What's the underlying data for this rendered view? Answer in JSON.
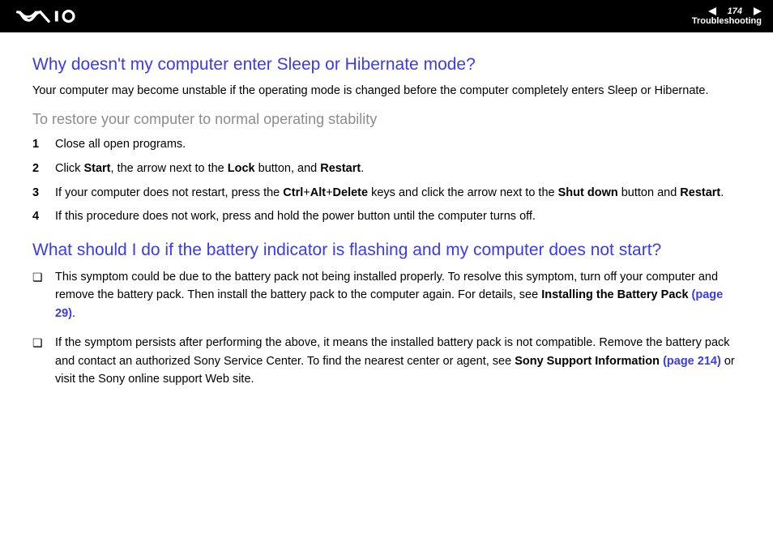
{
  "header": {
    "page_number": "174",
    "section": "Troubleshooting"
  },
  "q1": {
    "heading": "Why doesn't my computer enter Sleep or Hibernate mode?",
    "intro": "Your computer may become unstable if the operating mode is changed before the computer completely enters Sleep or Hibernate.",
    "subheading": "To restore your computer to normal operating stability",
    "steps": {
      "n1": "1",
      "s1": "Close all open programs.",
      "n2": "2",
      "s2_a": "Click ",
      "s2_b_start": "Start",
      "s2_c": ", the arrow next to the ",
      "s2_b_lock": "Lock",
      "s2_d": " button, and ",
      "s2_b_restart": "Restart",
      "s2_e": ".",
      "n3": "3",
      "s3_a": "If your computer does not restart, press the ",
      "s3_b_ctrl": "Ctrl",
      "s3_plus1": "+",
      "s3_b_alt": "Alt",
      "s3_plus2": "+",
      "s3_b_del": "Delete",
      "s3_c": " keys and click the arrow next to the ",
      "s3_b_shut": "Shut down",
      "s3_d": " button and ",
      "s3_b_restart": "Restart",
      "s3_e": ".",
      "n4": "4",
      "s4": "If this procedure does not work, press and hold the power button until the computer turns off."
    }
  },
  "q2": {
    "heading": "What should I do if the battery indicator is flashing and my computer does not start?",
    "b1_a": "This symptom could be due to the battery pack not being installed properly. To resolve this symptom, turn off your computer and remove the battery pack. Then install the battery pack to the computer again. For details, see ",
    "b1_bold": "Installing the Battery Pack ",
    "b1_link": "(page 29)",
    "b1_end": ".",
    "b2_a": "If the symptom persists after performing the above, it means the installed battery pack is not compatible. Remove the battery pack and contact an authorized Sony Service Center. To find the nearest center or agent, see ",
    "b2_bold": "Sony Support Information ",
    "b2_link": "(page 214)",
    "b2_end": " or visit the Sony online support Web site."
  }
}
